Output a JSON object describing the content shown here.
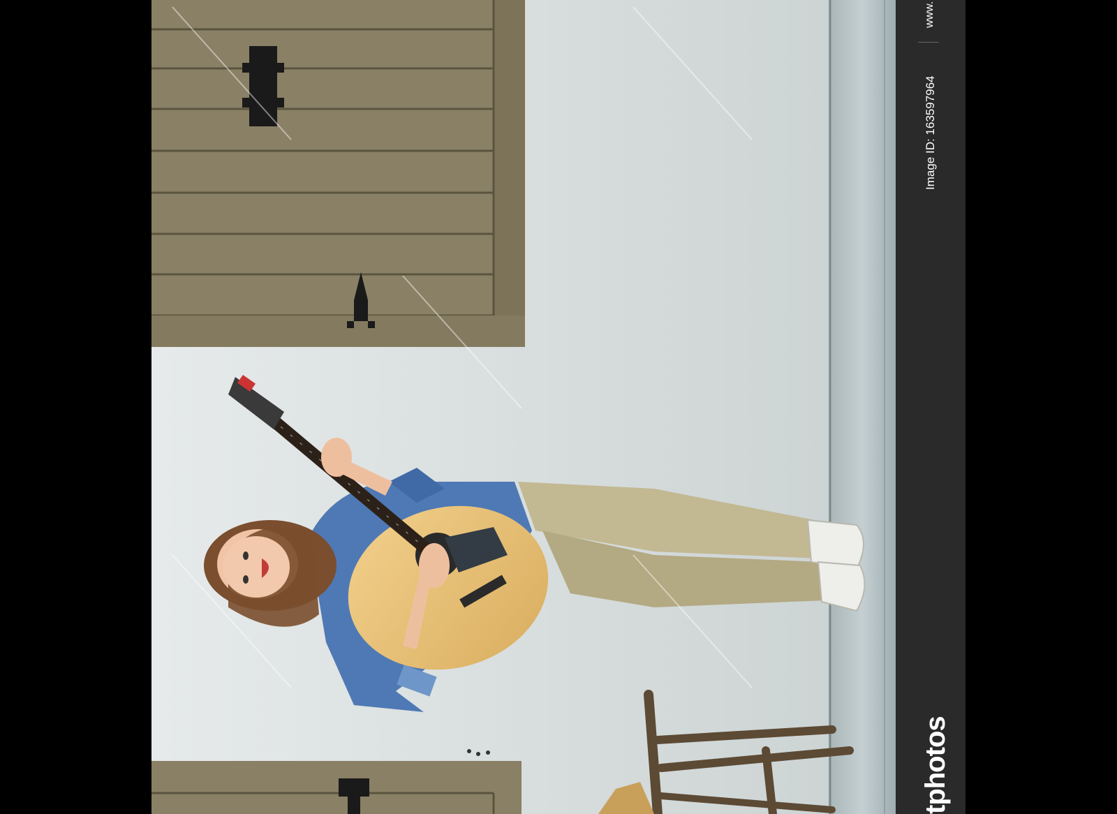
{
  "photo": {
    "description_icon": "guitar-player-photo",
    "watermark_text": "depositphotos"
  },
  "side_panel": {
    "url_fragment": "www.",
    "image_id": "Image ID: 163597964",
    "brand_fragment": "tphotos"
  },
  "colors": {
    "wall": "#dde2e2",
    "wood": "#8c8266",
    "floor": "#b6c2c4",
    "shirt": "#4f79b5",
    "pants": "#c0b58f",
    "guitar": "#e6c178",
    "panel": "#2a2a2a"
  }
}
